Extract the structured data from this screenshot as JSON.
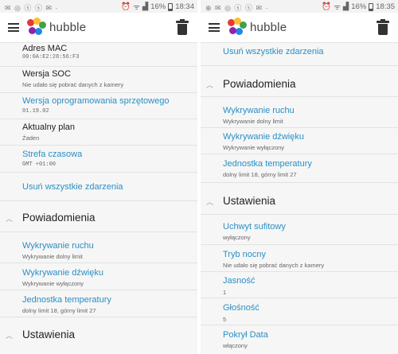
{
  "brand": {
    "name": "hubble",
    "colors": [
      "#e53935",
      "#fbc02d",
      "#43a047",
      "#1e88e5",
      "#8e24aa"
    ]
  },
  "accent_color": "#2a8fc4",
  "status_left": {
    "time": "18:34",
    "battery": "16%",
    "left_icons": "✉ ◎ ⓢ ⓢ ✉ ·"
  },
  "status_right": {
    "time": "18:35",
    "battery": "16%",
    "left_icons": "⊕ ✉ ◎ ⓢ ⓢ ✉ ·"
  },
  "left": {
    "items": [
      {
        "title": "Adres MAC",
        "sub": "00:0A:E2:28:56:F3"
      },
      {
        "title": "Wersja SOC",
        "sub": "Nie udało się pobrać danych z kamery"
      },
      {
        "title": "Wersja oprogramowania sprzętowego",
        "sub": "01.19.02"
      },
      {
        "title": "Aktualny plan",
        "sub": "Żaden"
      },
      {
        "title": "Strefa czasowa",
        "sub": "GMT +01:00"
      },
      {
        "title": "Usuń wszystkie zdarzenia"
      }
    ],
    "section_notifications": "Powiadomienia",
    "notifications": [
      {
        "title": "Wykrywanie ruchu",
        "sub": "Wykrywanie dolny limit"
      },
      {
        "title": "Wykrywanie dźwięku",
        "sub": "Wykrywanie wyłączony"
      },
      {
        "title": "Jednostka temperatury",
        "sub": "dolny limit 18, górny limit 27"
      }
    ],
    "section_settings": "Ustawienia"
  },
  "right": {
    "top_item": "Usuń wszystkie zdarzenia",
    "section_notifications": "Powiadomienia",
    "notifications": [
      {
        "title": "Wykrywanie ruchu",
        "sub": "Wykrywanie dolny limit"
      },
      {
        "title": "Wykrywanie dźwięku",
        "sub": "Wykrywanie wyłączony"
      },
      {
        "title": "Jednostka temperatury",
        "sub": "dolny limit 18, górny limit 27"
      }
    ],
    "section_settings": "Ustawienia",
    "settings": [
      {
        "title": "Uchwyt sufitowy",
        "sub": "wyłączony"
      },
      {
        "title": "Tryb nocny",
        "sub": "Nie udało się pobrać danych z kamery"
      },
      {
        "title": "Jasność",
        "sub": "1"
      },
      {
        "title": "Głośność",
        "sub": "5"
      },
      {
        "title": "Pokrył Data",
        "sub": "włączony"
      }
    ]
  }
}
